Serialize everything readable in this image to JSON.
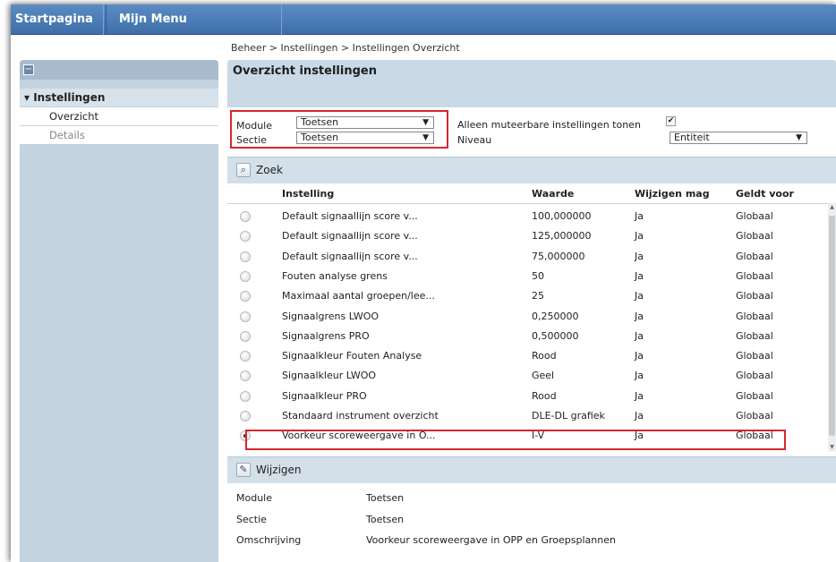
{
  "nav": {
    "home": "Startpagina",
    "menu": "Mijn Menu"
  },
  "breadcrumb": "Beheer > Instellingen > Instellingen Overzicht",
  "sidebar": {
    "collapse_glyph": "−",
    "root": "▾ Instellingen",
    "items": [
      {
        "label": "Overzicht"
      },
      {
        "label": "Details"
      }
    ]
  },
  "main": {
    "title": "Overzicht instellingen",
    "filters": {
      "module_label": "Module",
      "module_value": "Toetsen",
      "sectie_label": "Sectie",
      "sectie_value": "Toetsen",
      "muteerbaar_label": "Alleen muteerbare instellingen tonen",
      "muteerbaar_checked": true,
      "niveau_label": "Niveau",
      "niveau_value": "Entiteit",
      "arrow": "▼"
    },
    "zoek_label": "Zoek",
    "columns": [
      "Instelling",
      "Waarde",
      "Wijzigen mag",
      "Geldt voor"
    ],
    "rows": [
      {
        "instelling": "Default signaallijn score v...",
        "waarde": "100,000000",
        "wijzigen": "Ja",
        "geldt": "Globaal"
      },
      {
        "instelling": "Default signaallijn score v...",
        "waarde": "125,000000",
        "wijzigen": "Ja",
        "geldt": "Globaal"
      },
      {
        "instelling": "Default signaallijn score v...",
        "waarde": "75,000000",
        "wijzigen": "Ja",
        "geldt": "Globaal"
      },
      {
        "instelling": "Fouten analyse grens",
        "waarde": "50",
        "wijzigen": "Ja",
        "geldt": "Globaal"
      },
      {
        "instelling": "Maximaal aantal groepen/lee...",
        "waarde": "25",
        "wijzigen": "Ja",
        "geldt": "Globaal"
      },
      {
        "instelling": "Signaalgrens LWOO",
        "waarde": "0,250000",
        "wijzigen": "Ja",
        "geldt": "Globaal"
      },
      {
        "instelling": "Signaalgrens PRO",
        "waarde": "0,500000",
        "wijzigen": "Ja",
        "geldt": "Globaal"
      },
      {
        "instelling": "Signaalkleur Fouten Analyse",
        "waarde": "Rood",
        "wijzigen": "Ja",
        "geldt": "Globaal"
      },
      {
        "instelling": "Signaalkleur LWOO",
        "waarde": "Geel",
        "wijzigen": "Ja",
        "geldt": "Globaal"
      },
      {
        "instelling": "Signaalkleur PRO",
        "waarde": "Rood",
        "wijzigen": "Ja",
        "geldt": "Globaal"
      },
      {
        "instelling": "Standaard instrument overzicht",
        "waarde": "DLE-DL grafiek",
        "wijzigen": "Ja",
        "geldt": "Globaal"
      },
      {
        "instelling": "Voorkeur scoreweergave in O...",
        "waarde": "I-V",
        "wijzigen": "Ja",
        "geldt": "Globaal"
      }
    ],
    "selected_row": 11,
    "wijzigen_label": "Wijzigen",
    "details": [
      {
        "label": "Module",
        "value": "Toetsen"
      },
      {
        "label": "Sectie",
        "value": "Toetsen"
      },
      {
        "label": "Omschrijving",
        "value": "Voorkeur scoreweergave in OPP en Groepsplannen"
      }
    ]
  },
  "colors": {
    "nav": "#4a7db8",
    "panel": "#c9d9e6",
    "highlight": "#d9262e"
  }
}
